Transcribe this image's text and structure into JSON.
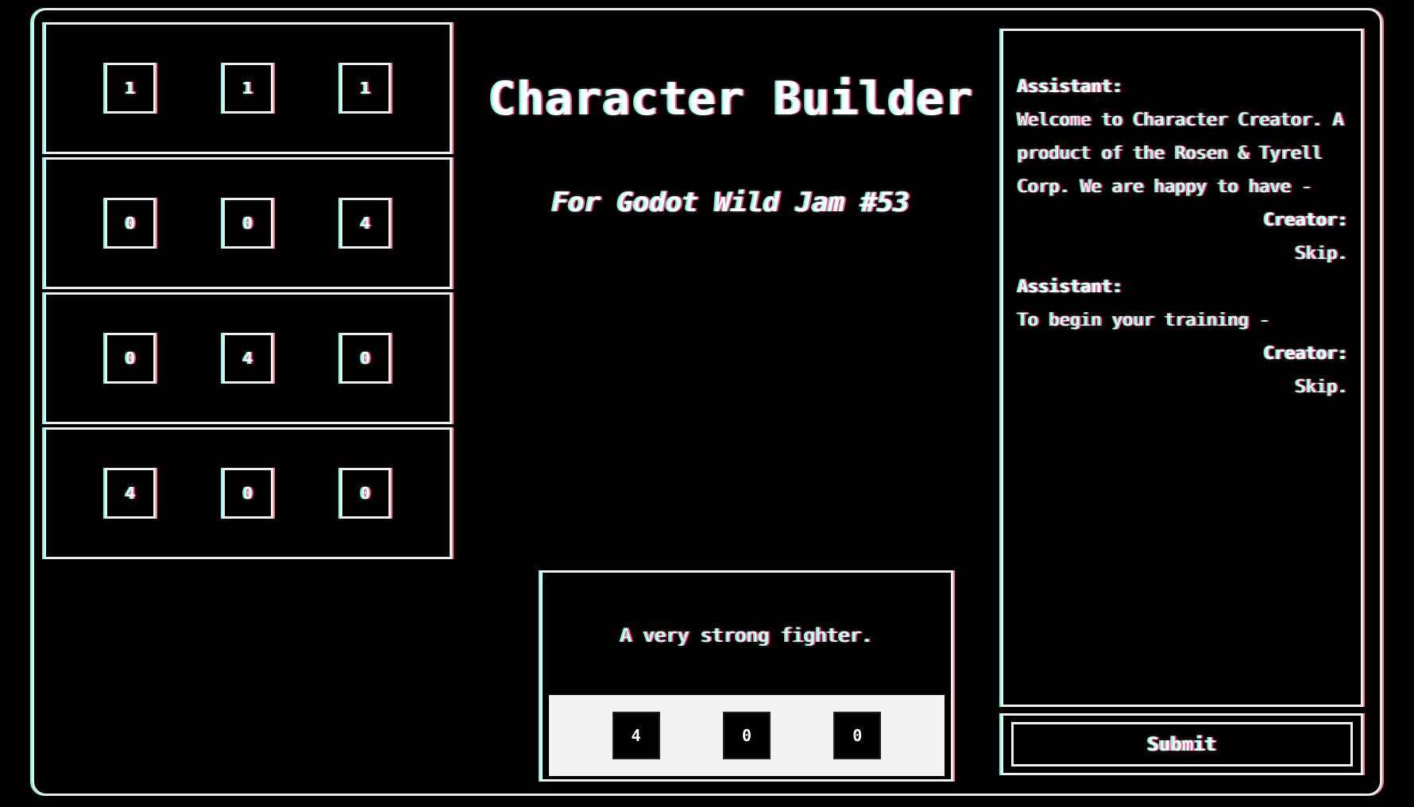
{
  "title": "Character Builder",
  "subtitle": "For Godot Wild Jam #53",
  "stat_rows": [
    {
      "values": [
        "1",
        "1",
        "1"
      ]
    },
    {
      "values": [
        "0",
        "0",
        "4"
      ]
    },
    {
      "values": [
        "0",
        "4",
        "0"
      ]
    },
    {
      "values": [
        "4",
        "0",
        "0"
      ]
    }
  ],
  "selected_card": {
    "description": "A very strong fighter.",
    "values": [
      "4",
      "0",
      "0"
    ]
  },
  "dialog": [
    {
      "speaker": "Assistant:",
      "text": "Welcome to Character Creator. A product of the Rosen & Tyrell Corp. We are happy to have -",
      "align": "left"
    },
    {
      "speaker": "Creator:",
      "text": "Skip.",
      "align": "right"
    },
    {
      "speaker": "Assistant:",
      "text": "To begin your training -",
      "align": "left"
    },
    {
      "speaker": "Creator:",
      "text": "Skip.",
      "align": "right"
    }
  ],
  "submit_label": "Submit",
  "colors": {
    "foreground": "#ffffff",
    "background": "#000000",
    "fringe_red": "#ff4f8a",
    "fringe_cyan": "#4fffd8"
  }
}
